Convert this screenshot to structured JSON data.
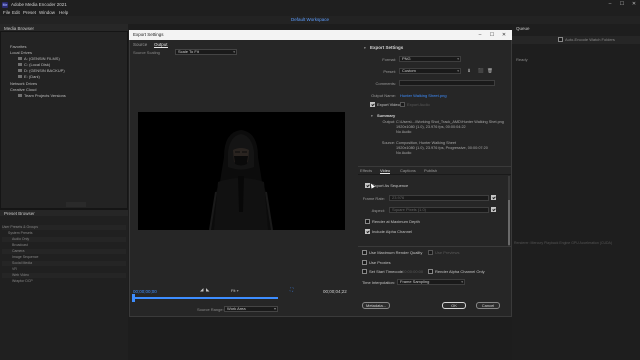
{
  "app": {
    "title": "Adobe Media Encoder 2021",
    "logo": "Me"
  },
  "menu": [
    "File",
    "Edit",
    "Preset",
    "Window",
    "Help"
  ],
  "workspace": {
    "tab": "Default Workspace"
  },
  "left_panel": {
    "title": "Media Browser",
    "tree": [
      {
        "label": "Favorites",
        "level": 0
      },
      {
        "label": "Local Drives",
        "level": 0
      },
      {
        "label": "A: (GENSIN FILMS)",
        "level": 1
      },
      {
        "label": "C: (Local Disk)",
        "level": 1
      },
      {
        "label": "D: (GENSIN BACKUP)",
        "level": 1
      },
      {
        "label": "E: (Dani)",
        "level": 1
      },
      {
        "label": "Network Drives",
        "level": 0
      },
      {
        "label": "Creative Cloud",
        "level": 0
      },
      {
        "label": "Team Projects Versions",
        "level": 1
      }
    ]
  },
  "left_bottom": {
    "title": "Preset Browser",
    "rows": [
      "User Presets & Groups",
      "System Presets",
      "Audio Only",
      "Broadcast",
      "Camera",
      "Image Sequence",
      "Social Media",
      "VR",
      "Web Video",
      "Wraptor DCP"
    ]
  },
  "dialog": {
    "title": "Export Settings",
    "tabs": [
      "Source",
      "Output"
    ],
    "active_tab": "Output",
    "source_scaling_label": "Source Scaling",
    "source_scaling_value": "Scale To Fit",
    "timecode_in": "00;00;00;00",
    "timecode_out": "00;00;04;22",
    "fit_value": "Fit",
    "source_range_label": "Source Range:",
    "source_range_value": "Work Area",
    "export_settings": {
      "heading": "Export Settings",
      "format_label": "Format:",
      "format_value": "PNG",
      "preset_label": "Preset:",
      "preset_value": "Custom",
      "comments_label": "Comments:",
      "output_name_label": "Output Name:",
      "output_name_value": "Hunter Walking Sheet.png",
      "export_video_label": "Export Video",
      "export_audio_label": "Export Audio",
      "summary_heading": "Summary",
      "output_label": "Output:",
      "output_lines": "C:\\Users\\...\\Working Shot_Track_AMD\\Hunter Walking Shet.png\n1920x1080 (1.0), 23.976 fps, 00:00:04:22\nNo Audio",
      "source_label": "Source:",
      "source_lines": "Composition, Hunter Walking Sheet\n1920x1080 (1.0), 23.976 fps, Progressive, 00:00:07:20\nNo Audio"
    },
    "sub_tabs": [
      "Effects",
      "Video",
      "Captions",
      "Publish"
    ],
    "active_sub_tab": "Video",
    "video": {
      "export_sequence_label": "Export As Sequence",
      "frame_rate_label": "Frame Rate:",
      "frame_rate_value": "23.976",
      "aspect_label": "Aspect:",
      "aspect_value": "Square Pixels (1.0)",
      "render_max_depth_label": "Render at Maximum Depth",
      "include_alpha_label": "Include Alpha Channel"
    },
    "bottom_options": {
      "max_render_quality": "Use Maximum Render Quality",
      "use_previews": "Use Previews",
      "use_proxies": "Use Proxies",
      "set_start_timecode": "Set Start Timecode",
      "start_timecode_value": "00:00:00:00",
      "render_alpha_only": "Render Alpha Channel Only",
      "time_interpolation_label": "Time Interpolation:",
      "time_interpolation_value": "Frame Sampling"
    },
    "buttons": {
      "metadata": "Metadata...",
      "ok": "OK",
      "cancel": "Cancel"
    }
  },
  "right_panel": {
    "title": "Queue",
    "auto_start_label": "Auto-Encode Watch Folders",
    "status_text": "Ready",
    "footer": "Renderer: Mercury Playback Engine GPU Acceleration (CUDA)"
  },
  "colors": {
    "accent_blue": "#3d8dff",
    "dialog_bg": "#262626",
    "app_bg": "#1d1d1d"
  }
}
